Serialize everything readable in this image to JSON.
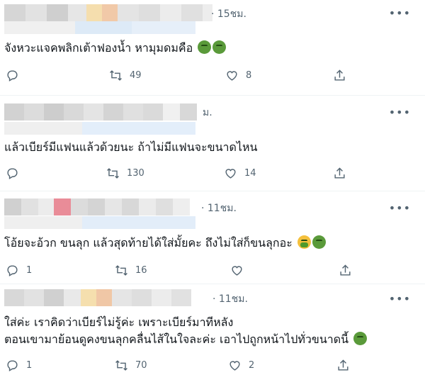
{
  "tweets": [
    {
      "time": "· 15ชม.",
      "text_lines": [
        "จังหวะแจคพลิกเต้าฟองน้ำ หามุมดมคือ"
      ],
      "emoji": [
        "sick-face-emoji",
        "sick-face-emoji"
      ],
      "stats": {
        "replies": "",
        "retweets": "49",
        "likes": "8"
      }
    },
    {
      "time": "ม.",
      "text_lines": [
        "แล้วเบียร์มีแฟนแล้วด้วยนะ ถ้าไม่มีแฟนจะขนาดไหน"
      ],
      "emoji": [],
      "stats": {
        "replies": "",
        "retweets": "130",
        "likes": "14"
      }
    },
    {
      "time": "· 11ชม.",
      "text_lines": [
        "โอ้ยจะอ้วก ขนลุก แล้วสุดท้ายได้ใส่มั้ยคะ ถึงไม่ใส่ก็ขนลุกอะ"
      ],
      "emoji": [
        "vomit-face-emoji",
        "sick-face-emoji"
      ],
      "stats": {
        "replies": "1",
        "retweets": "16",
        "likes": ""
      }
    },
    {
      "time": "· 11ชม.",
      "text_lines": [
        "ใส่ค่ะ เราคิดว่าเบียร์ไม่รู้ค่ะ เพราะเบียร์มาทีหลัง",
        "ตอนเขามาย้อนดูคงขนลุกคลื่นไส้ในใจละค่ะ เอาไปถูกหน้าไปทั่วขนาดนี้"
      ],
      "emoji": [
        "sick-face-emoji"
      ],
      "stats": {
        "replies": "1",
        "retweets": "70",
        "likes": "2"
      }
    }
  ],
  "more_label": "•••",
  "colors": {
    "icon": "#536471",
    "text": "#0f1419",
    "divider": "#eff3f4"
  }
}
